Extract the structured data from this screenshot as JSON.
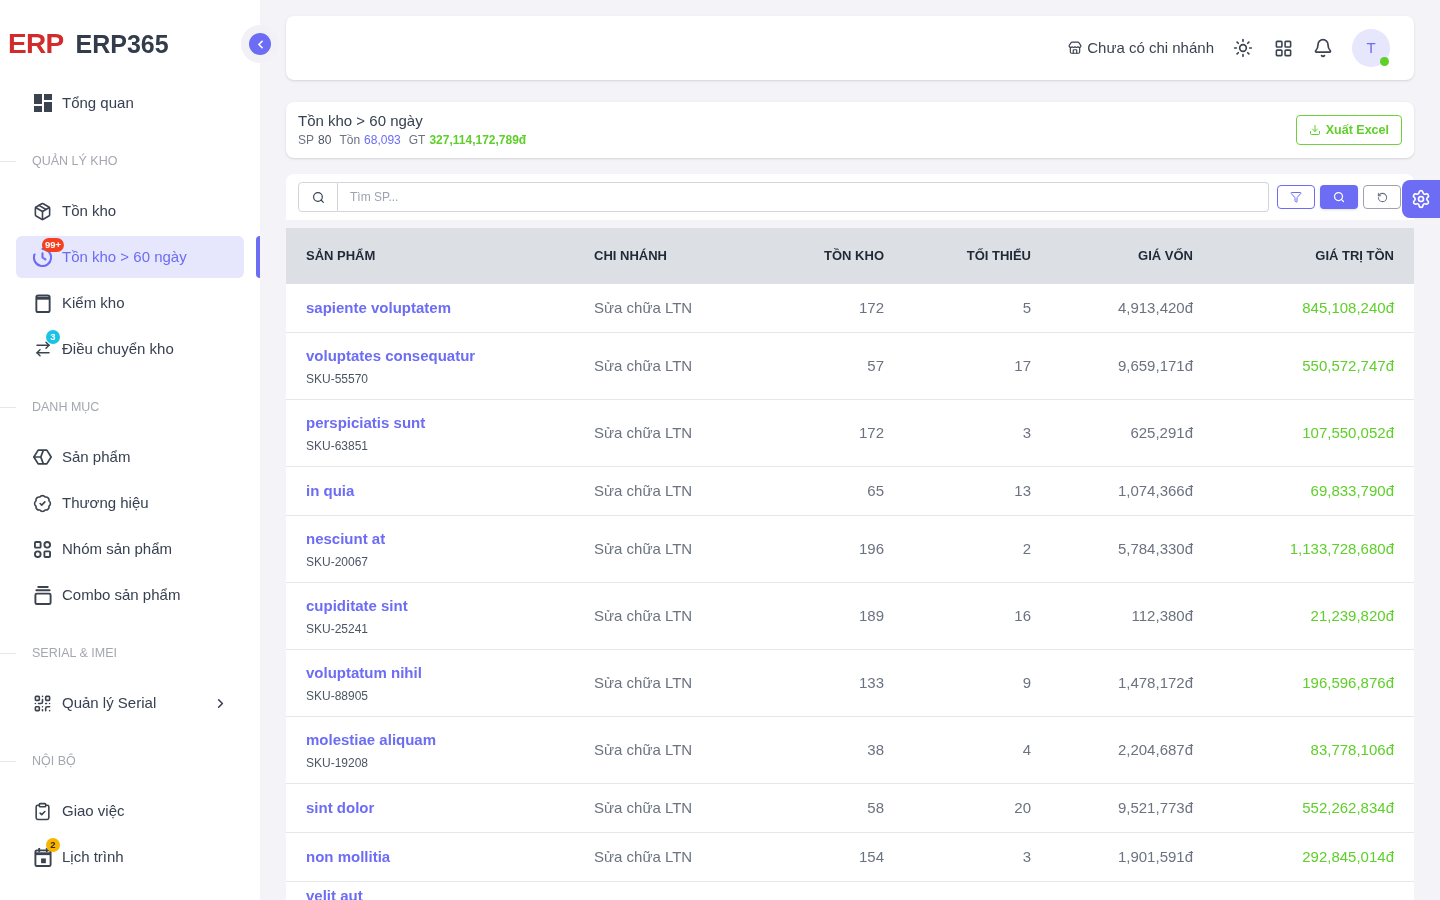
{
  "sidebar": {
    "logo": {
      "mark": "ERP",
      "name": "ERP365"
    },
    "sections": [
      {
        "items": [
          {
            "label": "Tổng quan",
            "selected": false
          }
        ]
      },
      {
        "title": "QUẢN LÝ KHO",
        "items": [
          {
            "label": "Tồn kho",
            "selected": false
          },
          {
            "label": "Tồn kho > 60 ngày",
            "selected": true,
            "badge": {
              "text": "99+",
              "color": "#f4401e"
            }
          },
          {
            "label": "Kiểm kho",
            "selected": false
          },
          {
            "label": "Điều chuyển kho",
            "selected": false,
            "badge": {
              "text": "3",
              "color": "#19c3e6"
            }
          }
        ]
      },
      {
        "title": "DANH MỤC",
        "items": [
          {
            "label": "Sản phẩm",
            "selected": false
          },
          {
            "label": "Thương hiệu",
            "selected": false
          },
          {
            "label": "Nhóm sản phẩm",
            "selected": false
          },
          {
            "label": "Combo sản phẩm",
            "selected": false
          }
        ]
      },
      {
        "title": "SERIAL & IMEI",
        "items": [
          {
            "label": "Quản lý Serial",
            "selected": false,
            "expanded": false
          }
        ]
      },
      {
        "title": "NỘI BỘ",
        "items": [
          {
            "label": "Giao việc",
            "selected": false
          },
          {
            "label": "Lịch trình",
            "selected": false,
            "badge": {
              "text": "2",
              "color": "#f7b500"
            }
          }
        ]
      }
    ]
  },
  "header": {
    "branch": "Chưa có chi nhánh",
    "user": {
      "initial": "T",
      "online": true
    }
  },
  "page": {
    "title": "Tồn kho > 60 ngày",
    "stats": [
      {
        "label": "SP",
        "value": "80",
        "color": "#4b5563",
        "emphasized": false
      },
      {
        "label": "Tồn",
        "value": "68,093",
        "color": "#6c6cf5",
        "emphasized": false
      },
      {
        "label": "GT",
        "value": "327,114,172,789đ",
        "color": "#5fcf2a",
        "emphasized": true
      }
    ],
    "export_button": "Xuất Excel"
  },
  "search": {
    "placeholder": "Tìm SP..."
  },
  "table": {
    "columns": [
      "SẢN PHẨM",
      "CHI NHÁNH",
      "TỒN KHO",
      "TỐI THIỂU",
      "GIÁ VỐN",
      "GIÁ TRỊ TỒN"
    ],
    "rows": [
      {
        "name": "sapiente voluptatem",
        "branch": "Sửa chữa LTN",
        "stock": "172",
        "min": "5",
        "cost": "4,913,420đ",
        "value": "845,108,240đ"
      },
      {
        "name": "voluptates consequatur",
        "sku": "SKU-55570",
        "branch": "Sửa chữa LTN",
        "stock": "57",
        "min": "17",
        "cost": "9,659,171đ",
        "value": "550,572,747đ"
      },
      {
        "name": "perspiciatis sunt",
        "sku": "SKU-63851",
        "branch": "Sửa chữa LTN",
        "stock": "172",
        "min": "3",
        "cost": "625,291đ",
        "value": "107,550,052đ"
      },
      {
        "name": "in quia",
        "branch": "Sửa chữa LTN",
        "stock": "65",
        "min": "13",
        "cost": "1,074,366đ",
        "value": "69,833,790đ"
      },
      {
        "name": "nesciunt at",
        "sku": "SKU-20067",
        "branch": "Sửa chữa LTN",
        "stock": "196",
        "min": "2",
        "cost": "5,784,330đ",
        "value": "1,133,728,680đ"
      },
      {
        "name": "cupiditate sint",
        "sku": "SKU-25241",
        "branch": "Sửa chữa LTN",
        "stock": "189",
        "min": "16",
        "cost": "112,380đ",
        "value": "21,239,820đ"
      },
      {
        "name": "voluptatum nihil",
        "sku": "SKU-88905",
        "branch": "Sửa chữa LTN",
        "stock": "133",
        "min": "9",
        "cost": "1,478,172đ",
        "value": "196,596,876đ"
      },
      {
        "name": "molestiae aliquam",
        "sku": "SKU-19208",
        "branch": "Sửa chữa LTN",
        "stock": "38",
        "min": "4",
        "cost": "2,204,687đ",
        "value": "83,778,106đ"
      },
      {
        "name": "sint dolor",
        "branch": "Sửa chữa LTN",
        "stock": "58",
        "min": "20",
        "cost": "9,521,773đ",
        "value": "552,262,834đ"
      },
      {
        "name": "non mollitia",
        "branch": "Sửa chữa LTN",
        "stock": "154",
        "min": "3",
        "cost": "1,901,591đ",
        "value": "292,845,014đ"
      },
      {
        "name": "velit aut"
      }
    ]
  }
}
